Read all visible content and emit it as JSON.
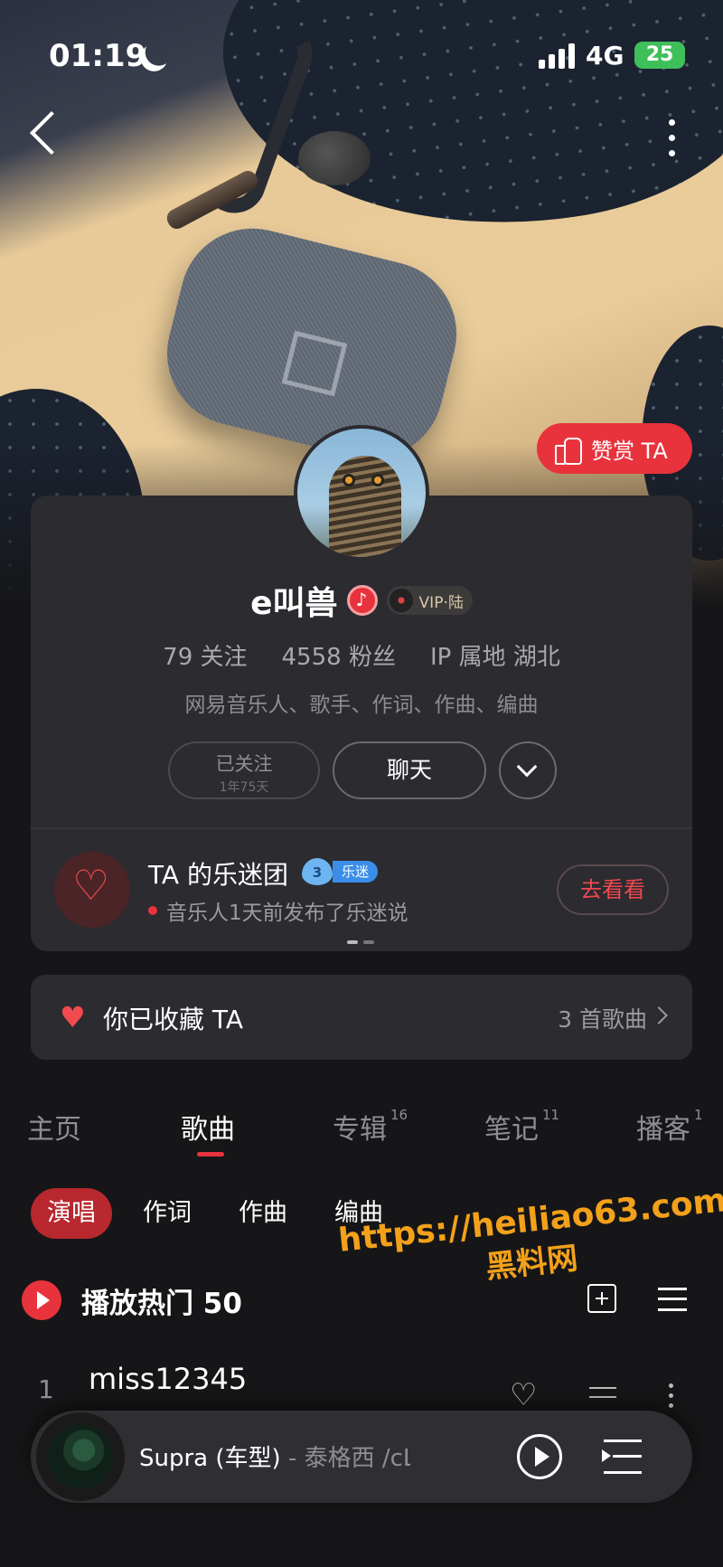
{
  "status_bar": {
    "time": "01:19",
    "network": "4G",
    "battery": "25"
  },
  "profile": {
    "reward_label": "赞赏 TA",
    "name": "e叫兽",
    "vip_label": "VIP·陆",
    "stats": {
      "following": "79 关注",
      "fans": "4558 粉丝",
      "ip_location": "IP 属地 湖北"
    },
    "bio": "网易音乐人、歌手、作词、作曲、编曲",
    "follow_label": "已关注",
    "follow_duration": "1年75天",
    "chat_label": "聊天"
  },
  "fan_club": {
    "title": "TA 的乐迷团",
    "level": "3",
    "level_tag": "乐迷",
    "subtitle": "音乐人1天前发布了乐迷说",
    "go_view_label": "去看看"
  },
  "collected": {
    "label": "你已收藏 TA",
    "count": "3 首歌曲"
  },
  "tabs": [
    {
      "label": "主页",
      "badge": ""
    },
    {
      "label": "歌曲",
      "badge": ""
    },
    {
      "label": "专辑",
      "badge": "16"
    },
    {
      "label": "笔记",
      "badge": "11"
    },
    {
      "label": "播客",
      "badge": "1"
    }
  ],
  "subtabs": [
    "演唱",
    "作词",
    "作曲",
    "编曲"
  ],
  "play_hot_label": "播放热门 50",
  "watermark": {
    "url": "https://heiliao63.com",
    "name": "黑料网"
  },
  "songs": [
    {
      "index": "1",
      "title": "miss12345"
    }
  ],
  "mini_player": {
    "title": "Supra (车型)",
    "artist": " - 泰格西 /cLoner"
  }
}
